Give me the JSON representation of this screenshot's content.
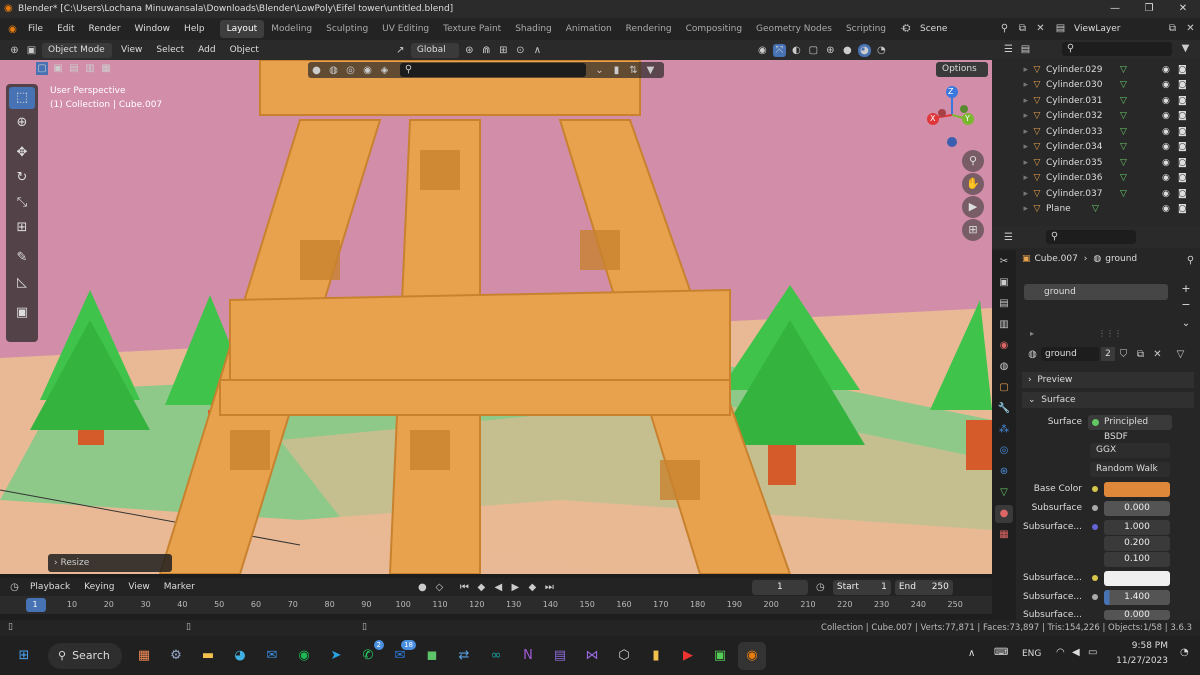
{
  "window": {
    "title": "Blender* [C:\\Users\\Lochana Minuwansala\\Downloads\\Blender\\LowPoly\\Eifel tower\\untitled.blend]"
  },
  "menu": [
    "File",
    "Edit",
    "Render",
    "Window",
    "Help"
  ],
  "workspaces": [
    "Layout",
    "Modeling",
    "Sculpting",
    "UV Editing",
    "Texture Paint",
    "Shading",
    "Animation",
    "Rendering",
    "Compositing",
    "Geometry Nodes",
    "Scripting"
  ],
  "active_workspace": "Layout",
  "scene": {
    "name": "Scene",
    "view_layer": "ViewLayer"
  },
  "viewport_header": {
    "mode": "Object Mode",
    "menus": [
      "View",
      "Select",
      "Add",
      "Object"
    ],
    "transform": "Global",
    "options": "Options"
  },
  "viewport": {
    "perspective": "User Perspective",
    "collection": "(1) Collection | Cube.007",
    "resize_panel": "Resize",
    "gizmo": {
      "z": "Z",
      "y": "Y",
      "x": "X"
    }
  },
  "outliner": {
    "items": [
      "Cylinder.029",
      "Cylinder.030",
      "Cylinder.031",
      "Cylinder.032",
      "Cylinder.033",
      "Cylinder.034",
      "Cylinder.035",
      "Cylinder.036",
      "Cylinder.037",
      "Plane"
    ]
  },
  "properties": {
    "object": "Cube.007",
    "material": "ground",
    "slot": "ground",
    "material_field": "ground",
    "users": "2",
    "preview_label": "Preview",
    "surface_section": "Surface",
    "surface_label": "Surface",
    "surface_value": "Principled BSDF",
    "distribution": "GGX",
    "subsurface_method": "Random Walk",
    "base_color_label": "Base Color",
    "base_color": "#e0883a",
    "subsurface_label": "Subsurface",
    "subsurface_value": "0.000",
    "subsurface_radius_label": "Subsurface...",
    "radius": [
      "1.000",
      "0.200",
      "0.100"
    ],
    "subsurface_color_label": "Subsurface...",
    "subsurface_ior_label": "Subsurface...",
    "subsurface_ior": "1.400",
    "subsurface_aniso_label": "Subsurface...",
    "subsurface_aniso": "0.000"
  },
  "timeline": {
    "menus": [
      "Playback",
      "Keying",
      "View",
      "Marker"
    ],
    "current_frame": "1",
    "start_label": "Start",
    "start": "1",
    "end_label": "End",
    "end": "250",
    "frames": [
      "1",
      "10",
      "20",
      "30",
      "40",
      "50",
      "60",
      "70",
      "80",
      "90",
      "100",
      "110",
      "120",
      "130",
      "140",
      "150",
      "160",
      "170",
      "180",
      "190",
      "200",
      "210",
      "220",
      "230",
      "240",
      "250"
    ]
  },
  "status": "Collection | Cube.007 | Verts:77,871 | Faces:73,897 | Tris:154,226 | Objects:1/58 | 3.6.3",
  "taskbar": {
    "search": "Search",
    "lang": "ENG",
    "time": "9:58 PM",
    "date": "11/27/2023",
    "badges": [
      "2",
      "18"
    ]
  }
}
